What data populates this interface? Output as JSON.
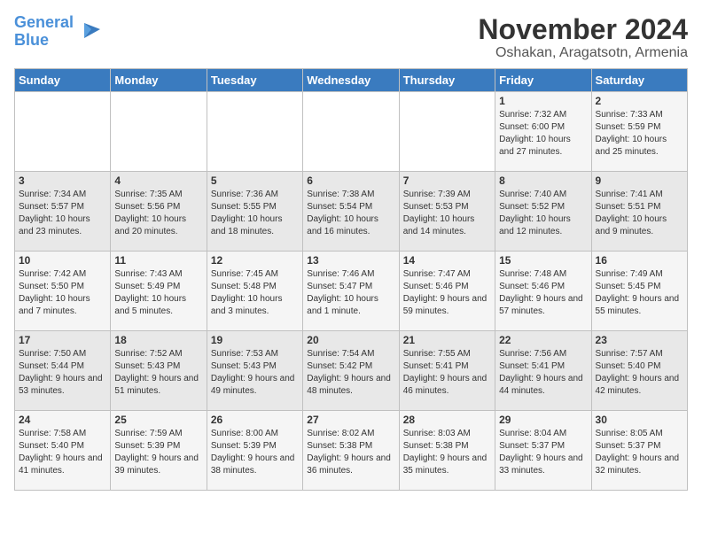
{
  "logo": {
    "line1": "General",
    "line2": "Blue"
  },
  "title": "November 2024",
  "subtitle": "Oshakan, Aragatsotn, Armenia",
  "days_of_week": [
    "Sunday",
    "Monday",
    "Tuesday",
    "Wednesday",
    "Thursday",
    "Friday",
    "Saturday"
  ],
  "weeks": [
    [
      {
        "day": "",
        "info": ""
      },
      {
        "day": "",
        "info": ""
      },
      {
        "day": "",
        "info": ""
      },
      {
        "day": "",
        "info": ""
      },
      {
        "day": "",
        "info": ""
      },
      {
        "day": "1",
        "info": "Sunrise: 7:32 AM\nSunset: 6:00 PM\nDaylight: 10 hours and 27 minutes."
      },
      {
        "day": "2",
        "info": "Sunrise: 7:33 AM\nSunset: 5:59 PM\nDaylight: 10 hours and 25 minutes."
      }
    ],
    [
      {
        "day": "3",
        "info": "Sunrise: 7:34 AM\nSunset: 5:57 PM\nDaylight: 10 hours and 23 minutes."
      },
      {
        "day": "4",
        "info": "Sunrise: 7:35 AM\nSunset: 5:56 PM\nDaylight: 10 hours and 20 minutes."
      },
      {
        "day": "5",
        "info": "Sunrise: 7:36 AM\nSunset: 5:55 PM\nDaylight: 10 hours and 18 minutes."
      },
      {
        "day": "6",
        "info": "Sunrise: 7:38 AM\nSunset: 5:54 PM\nDaylight: 10 hours and 16 minutes."
      },
      {
        "day": "7",
        "info": "Sunrise: 7:39 AM\nSunset: 5:53 PM\nDaylight: 10 hours and 14 minutes."
      },
      {
        "day": "8",
        "info": "Sunrise: 7:40 AM\nSunset: 5:52 PM\nDaylight: 10 hours and 12 minutes."
      },
      {
        "day": "9",
        "info": "Sunrise: 7:41 AM\nSunset: 5:51 PM\nDaylight: 10 hours and 9 minutes."
      }
    ],
    [
      {
        "day": "10",
        "info": "Sunrise: 7:42 AM\nSunset: 5:50 PM\nDaylight: 10 hours and 7 minutes."
      },
      {
        "day": "11",
        "info": "Sunrise: 7:43 AM\nSunset: 5:49 PM\nDaylight: 10 hours and 5 minutes."
      },
      {
        "day": "12",
        "info": "Sunrise: 7:45 AM\nSunset: 5:48 PM\nDaylight: 10 hours and 3 minutes."
      },
      {
        "day": "13",
        "info": "Sunrise: 7:46 AM\nSunset: 5:47 PM\nDaylight: 10 hours and 1 minute."
      },
      {
        "day": "14",
        "info": "Sunrise: 7:47 AM\nSunset: 5:46 PM\nDaylight: 9 hours and 59 minutes."
      },
      {
        "day": "15",
        "info": "Sunrise: 7:48 AM\nSunset: 5:46 PM\nDaylight: 9 hours and 57 minutes."
      },
      {
        "day": "16",
        "info": "Sunrise: 7:49 AM\nSunset: 5:45 PM\nDaylight: 9 hours and 55 minutes."
      }
    ],
    [
      {
        "day": "17",
        "info": "Sunrise: 7:50 AM\nSunset: 5:44 PM\nDaylight: 9 hours and 53 minutes."
      },
      {
        "day": "18",
        "info": "Sunrise: 7:52 AM\nSunset: 5:43 PM\nDaylight: 9 hours and 51 minutes."
      },
      {
        "day": "19",
        "info": "Sunrise: 7:53 AM\nSunset: 5:43 PM\nDaylight: 9 hours and 49 minutes."
      },
      {
        "day": "20",
        "info": "Sunrise: 7:54 AM\nSunset: 5:42 PM\nDaylight: 9 hours and 48 minutes."
      },
      {
        "day": "21",
        "info": "Sunrise: 7:55 AM\nSunset: 5:41 PM\nDaylight: 9 hours and 46 minutes."
      },
      {
        "day": "22",
        "info": "Sunrise: 7:56 AM\nSunset: 5:41 PM\nDaylight: 9 hours and 44 minutes."
      },
      {
        "day": "23",
        "info": "Sunrise: 7:57 AM\nSunset: 5:40 PM\nDaylight: 9 hours and 42 minutes."
      }
    ],
    [
      {
        "day": "24",
        "info": "Sunrise: 7:58 AM\nSunset: 5:40 PM\nDaylight: 9 hours and 41 minutes."
      },
      {
        "day": "25",
        "info": "Sunrise: 7:59 AM\nSunset: 5:39 PM\nDaylight: 9 hours and 39 minutes."
      },
      {
        "day": "26",
        "info": "Sunrise: 8:00 AM\nSunset: 5:39 PM\nDaylight: 9 hours and 38 minutes."
      },
      {
        "day": "27",
        "info": "Sunrise: 8:02 AM\nSunset: 5:38 PM\nDaylight: 9 hours and 36 minutes."
      },
      {
        "day": "28",
        "info": "Sunrise: 8:03 AM\nSunset: 5:38 PM\nDaylight: 9 hours and 35 minutes."
      },
      {
        "day": "29",
        "info": "Sunrise: 8:04 AM\nSunset: 5:37 PM\nDaylight: 9 hours and 33 minutes."
      },
      {
        "day": "30",
        "info": "Sunrise: 8:05 AM\nSunset: 5:37 PM\nDaylight: 9 hours and 32 minutes."
      }
    ]
  ]
}
